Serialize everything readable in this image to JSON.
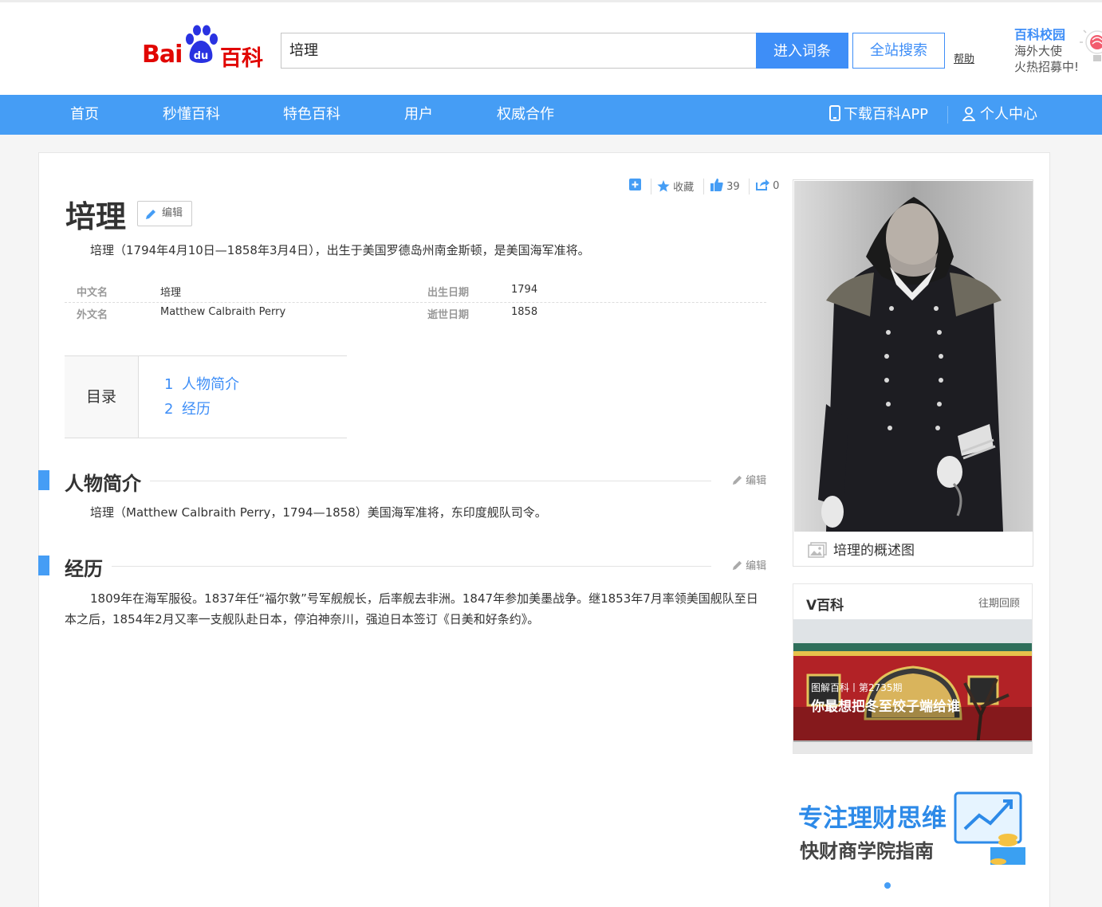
{
  "header": {
    "logo_bai": "Bai",
    "logo_du": "du",
    "logo_baike": "百科",
    "search_value": "培理",
    "enter_button": "进入词条",
    "site_search_button": "全站搜索",
    "help_link": "帮助",
    "campus_title": "百科校园",
    "campus_line1": "海外大使",
    "campus_line2": "火热招募中!"
  },
  "nav": {
    "items": [
      "首页",
      "秒懂百科",
      "特色百科",
      "用户",
      "权威合作"
    ],
    "download_app": "下载百科APP",
    "personal_center": "个人中心"
  },
  "tools": {
    "collect_label": "收藏",
    "like_count": "39",
    "share_count": "0"
  },
  "article": {
    "title": "培理",
    "edit_label": "编辑",
    "summary": "培理（1794年4月10日—1858年3月4日），出生于美国罗德岛州南金斯顿，是美国海军准将。",
    "infobox": {
      "chinese_name_key": "中文名",
      "chinese_name_val": "培理",
      "foreign_name_key": "外文名",
      "foreign_name_val": "Matthew Calbraith Perry",
      "birth_key": "出生日期",
      "birth_val": "1794",
      "death_key": "逝世日期",
      "death_val": "1858"
    },
    "toc": {
      "heading": "目录",
      "items": [
        {
          "num": "1",
          "label": "人物简介"
        },
        {
          "num": "2",
          "label": "经历"
        }
      ]
    },
    "sections": [
      {
        "title": "人物简介",
        "edit": "编辑",
        "text": "培理（Matthew Calbraith Perry，1794—1858）美国海军准将，东印度舰队司令。"
      },
      {
        "title": "经历",
        "edit": "编辑",
        "text": "1809年在海军服役。1837年任“福尔敦”号军舰舰长，后率舰去非洲。1847年参加美墨战争。继1853年7月率领美国舰队至日本之后，1854年2月又率一支舰队赴日本，停泊神奈川，强迫日本签订《日美和好条约》。"
      }
    ]
  },
  "sidebar": {
    "photo_caption": "培理的概述图",
    "vbaike_title": "V百科",
    "vbaike_more": "往期回顾",
    "vbaike_tag": "图解百科丨第2735期",
    "vbaike_caption": "你最想把冬至饺子端给谁",
    "ad_line1": "专注理财思维",
    "ad_line2": "快财商学院指南"
  },
  "colors": {
    "brand_blue": "#459df5",
    "link_blue": "#3e8ef7",
    "logo_red": "#e10602"
  }
}
